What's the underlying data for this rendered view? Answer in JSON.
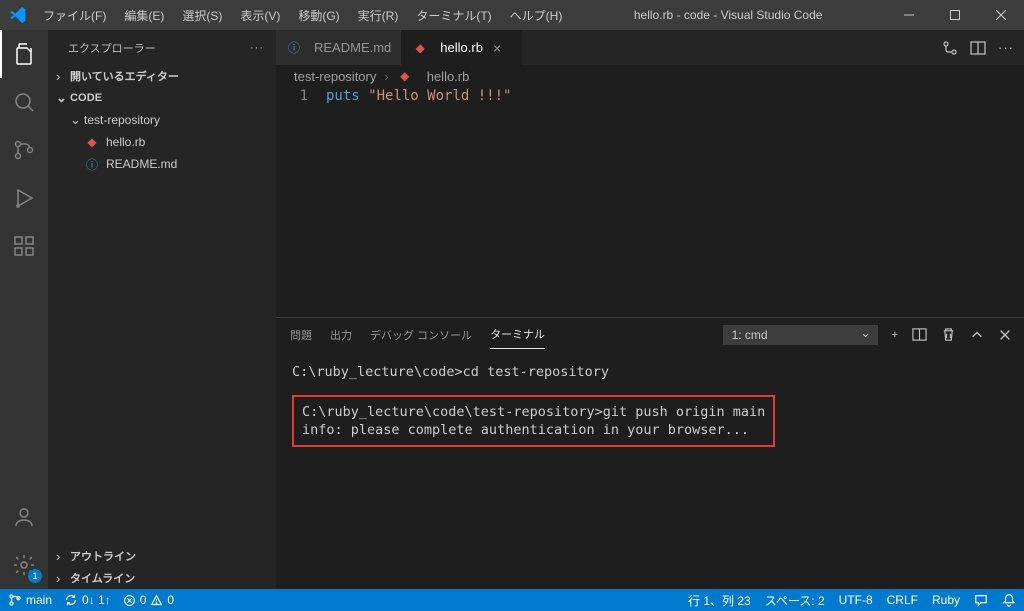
{
  "window": {
    "title": "hello.rb - code - Visual Studio Code"
  },
  "menu": {
    "file": "ファイル(F)",
    "edit": "編集(E)",
    "select": "選択(S)",
    "view": "表示(V)",
    "go": "移動(G)",
    "run": "実行(R)",
    "terminal": "ターミナル(T)",
    "help": "ヘルプ(H)"
  },
  "sidebar": {
    "title": "エクスプローラー",
    "open_editors": "開いているエディター",
    "workspace": "CODE",
    "folder": "test-repository",
    "files": {
      "hello": "hello.rb",
      "readme": "README.md"
    },
    "outline": "アウトライン",
    "timeline": "タイムライン"
  },
  "activity": {
    "settings_badge": "1"
  },
  "tabs": {
    "readme": "README.md",
    "hello": "hello.rb"
  },
  "breadcrumbs": {
    "repo": "test-repository",
    "file": "hello.rb"
  },
  "editor": {
    "line1_num": "1",
    "line1_kw": "puts",
    "line1_str": "\"Hello World !!!\""
  },
  "panel": {
    "problems": "問題",
    "output": "出力",
    "debug": "デバッグ コンソール",
    "terminal": "ターミナル",
    "shell": "1: cmd"
  },
  "terminal": {
    "line1": "C:\\ruby_lecture\\code>cd test-repository",
    "line2": "C:\\ruby_lecture\\code\\test-repository>git push origin main",
    "line3": "info: please complete authentication in your browser..."
  },
  "status": {
    "branch": "main",
    "sync": "0↓ 1↑",
    "errors": "0",
    "warnings": "0",
    "cursor": "行 1、列 23",
    "spaces": "スペース: 2",
    "encoding": "UTF-8",
    "eol": "CRLF",
    "lang": "Ruby"
  }
}
